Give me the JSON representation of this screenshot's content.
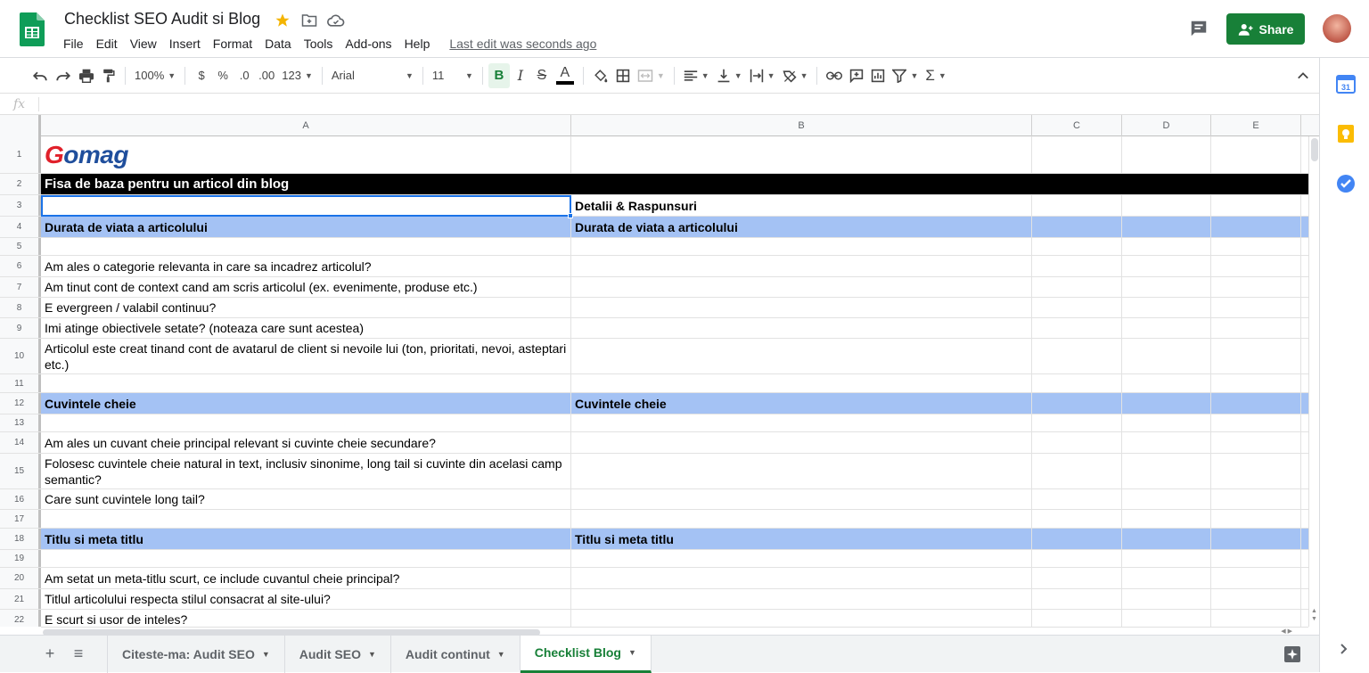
{
  "app": {
    "title": "Checklist SEO Audit si Blog",
    "last_edit": "Last edit was seconds ago",
    "share_label": "Share",
    "brand_color": "#188038"
  },
  "menu": [
    "File",
    "Edit",
    "View",
    "Insert",
    "Format",
    "Data",
    "Tools",
    "Add-ons",
    "Help"
  ],
  "toolbar": {
    "zoom": "100%",
    "currency": "$",
    "percent": "%",
    "dec_decrease": ".0",
    "dec_increase": ".00",
    "more_formats": "123",
    "font": "Arial",
    "font_size": "11",
    "bold": "B",
    "italic": "I",
    "strike": "S",
    "text_color": "A",
    "sum": "Σ"
  },
  "formula_bar": {
    "fx": "fx",
    "value": ""
  },
  "columns": [
    "A",
    "B",
    "C",
    "D",
    "E"
  ],
  "rows": [
    {
      "n": "1",
      "a": "Gomag",
      "b": "",
      "style": "logo"
    },
    {
      "n": "2",
      "a": "Fisa de baza pentru un articol din blog",
      "b": "",
      "style": "black"
    },
    {
      "n": "3",
      "a": "",
      "b": "Detalii & Raspunsuri",
      "style": "bold"
    },
    {
      "n": "4",
      "a": "Durata de viata a articolului",
      "b": "Durata de viata a articolului",
      "style": "blue"
    },
    {
      "n": "5",
      "a": "",
      "b": "",
      "style": ""
    },
    {
      "n": "6",
      "a": "Am ales o categorie relevanta in care sa incadrez articolul?",
      "b": "",
      "style": ""
    },
    {
      "n": "7",
      "a": "Am tinut cont de context cand am scris articolul (ex. evenimente, produse etc.)",
      "b": "",
      "style": ""
    },
    {
      "n": "8",
      "a": "E evergreen / valabil continuu?",
      "b": "",
      "style": ""
    },
    {
      "n": "9",
      "a": "Imi atinge obiectivele setate? (noteaza care sunt acestea)",
      "b": "",
      "style": ""
    },
    {
      "n": "10",
      "a": "Articolul este creat tinand cont de avatarul de client si nevoile lui (ton, prioritati, nevoi, asteptari etc.)",
      "b": "",
      "style": ""
    },
    {
      "n": "11",
      "a": "",
      "b": "",
      "style": ""
    },
    {
      "n": "12",
      "a": "Cuvintele cheie",
      "b": "Cuvintele cheie",
      "style": "blue"
    },
    {
      "n": "13",
      "a": "",
      "b": "",
      "style": ""
    },
    {
      "n": "14",
      "a": "Am ales un cuvant cheie principal relevant si cuvinte cheie secundare?",
      "b": "",
      "style": ""
    },
    {
      "n": "15",
      "a": "Folosesc cuvintele cheie natural in text, inclusiv sinonime, long tail si cuvinte din acelasi camp semantic?",
      "b": "",
      "style": ""
    },
    {
      "n": "16",
      "a": "Care sunt cuvintele long tail?",
      "b": "",
      "style": ""
    },
    {
      "n": "17",
      "a": "",
      "b": "",
      "style": ""
    },
    {
      "n": "18",
      "a": "Titlu si meta titlu",
      "b": "Titlu si meta titlu",
      "style": "blue"
    },
    {
      "n": "19",
      "a": "",
      "b": "",
      "style": ""
    },
    {
      "n": "20",
      "a": "Am setat un meta-titlu scurt, ce include cuvantul cheie principal?",
      "b": "",
      "style": ""
    },
    {
      "n": "21",
      "a": "Titlul articolului respecta stilul consacrat al site-ului?",
      "b": "",
      "style": ""
    },
    {
      "n": "22",
      "a": "E scurt si usor de inteles?",
      "b": "",
      "style": ""
    }
  ],
  "sheets": [
    {
      "label": "Citeste-ma: Audit SEO",
      "active": false
    },
    {
      "label": "Audit SEO",
      "active": false
    },
    {
      "label": "Audit continut",
      "active": false
    },
    {
      "label": "Checklist Blog",
      "active": true
    }
  ],
  "colors": {
    "header_fill": "#a4c2f4",
    "black_fill": "#000000",
    "selection": "#1a73e8"
  }
}
